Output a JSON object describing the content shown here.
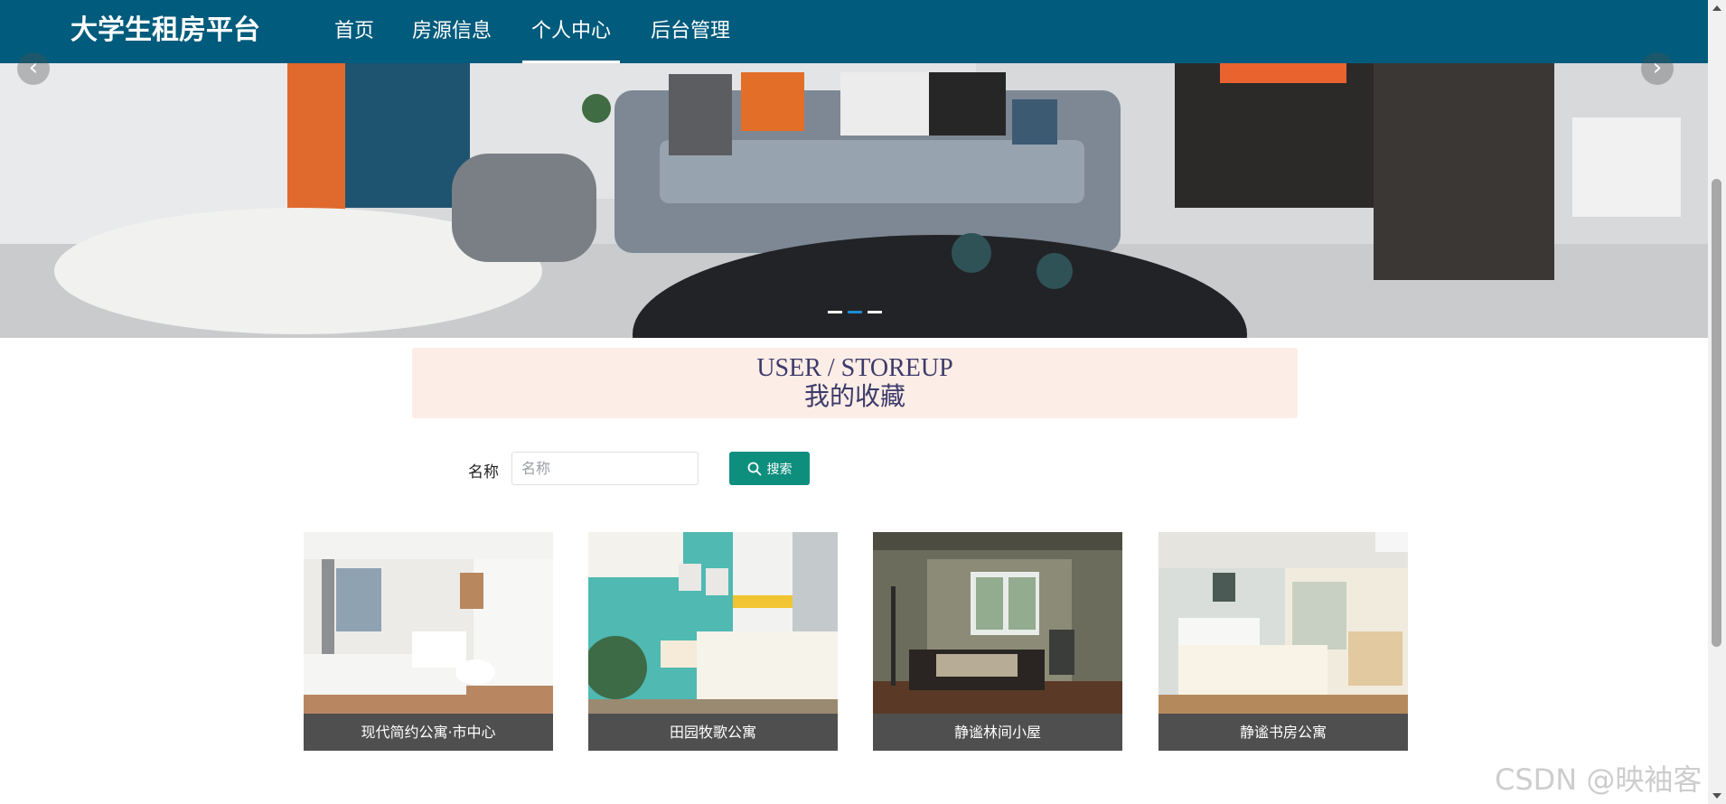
{
  "nav": {
    "brand": "大学生租房平台",
    "items": [
      {
        "label": "首页",
        "active": false
      },
      {
        "label": "房源信息",
        "active": false
      },
      {
        "label": "个人中心",
        "active": true
      },
      {
        "label": "后台管理",
        "active": false
      }
    ]
  },
  "carousel": {
    "prev_icon": "chevron-left-icon",
    "next_icon": "chevron-right-icon",
    "slide_count": 3,
    "active_slide": 2
  },
  "section": {
    "title_en": "USER / STOREUP",
    "title_zh": "我的收藏"
  },
  "search": {
    "label": "名称",
    "placeholder": "名称",
    "value": "",
    "button_label": "搜索",
    "button_icon": "search-icon"
  },
  "favorites": [
    {
      "title": "现代简约公寓·市中心"
    },
    {
      "title": "田园牧歌公寓"
    },
    {
      "title": "静谧林间小屋"
    },
    {
      "title": "静谧书房公寓"
    }
  ],
  "watermark": "CSDN @映袖客",
  "colors": {
    "nav_bg": "#005b7c",
    "section_bg": "#fcede6",
    "section_text": "#3d3b6b",
    "search_button": "#0e8f7e",
    "card_caption_bg": "#4f4f4f",
    "active_dot": "#1d8bd6"
  }
}
